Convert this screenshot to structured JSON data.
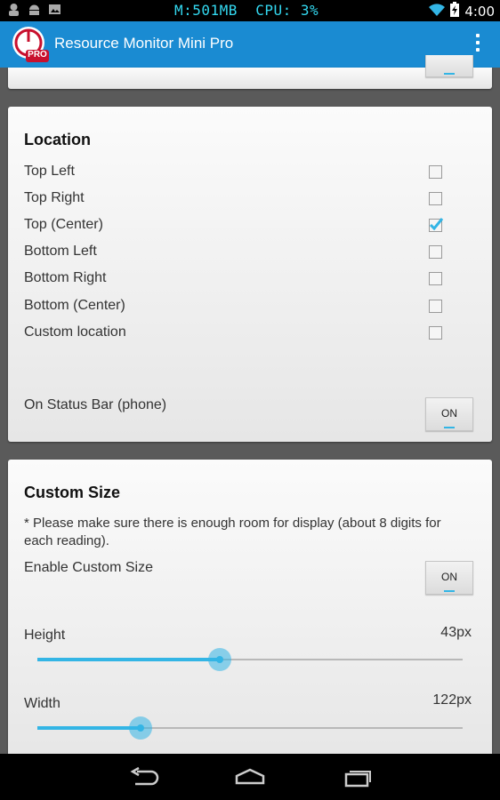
{
  "status_bar": {
    "monitor_text": "M:501MB  CPU: 3%",
    "time": "4:00"
  },
  "action_bar": {
    "title": "Resource Monitor Mini Pro",
    "app_icon_badge": "PRO",
    "accent_color": "#1a8bd2"
  },
  "top_card": {
    "icon": "partial-card"
  },
  "location": {
    "title": "Location",
    "options": [
      {
        "label": "Top Left",
        "checked": false
      },
      {
        "label": "Top Right",
        "checked": false
      },
      {
        "label": "Top (Center)",
        "checked": true
      },
      {
        "label": "Bottom Left",
        "checked": false
      },
      {
        "label": "Bottom Right",
        "checked": false
      },
      {
        "label": "Bottom (Center)",
        "checked": false
      },
      {
        "label": "Custom location",
        "checked": false
      }
    ],
    "status_bar_label": "On Status Bar (phone)",
    "status_bar_toggle": "ON"
  },
  "custom_size": {
    "title": "Custom Size",
    "note": "* Please make sure there is enough room for display (about 8 digits for each reading).",
    "enable_label": "Enable Custom Size",
    "enable_toggle": "ON",
    "height": {
      "label": "Height",
      "value_text": "43px",
      "fraction": 0.429
    },
    "width": {
      "label": "Width",
      "value_text": "122px",
      "fraction": 0.243
    }
  },
  "slider_color": "#33b5e5",
  "nav_bar": {
    "icons": [
      "back-icon",
      "home-icon",
      "recent-apps-icon"
    ]
  }
}
